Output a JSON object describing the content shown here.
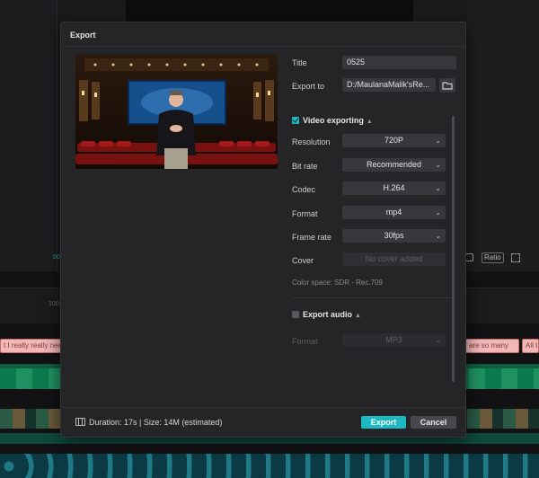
{
  "background": {
    "ratio_label": "Ratio",
    "time_left": "00",
    "ruler_mark": "100s",
    "captions": [
      "t I really really need",
      "are so many",
      "All t"
    ]
  },
  "dialog": {
    "title": "Export",
    "fields": {
      "title_label": "Title",
      "title_value": "0525",
      "export_to_label": "Export to",
      "export_to_value": "D:/MaulanaMalik'sRe..."
    },
    "video": {
      "heading": "Video exporting",
      "checked": true,
      "rows": [
        {
          "label": "Resolution",
          "value": "720P"
        },
        {
          "label": "Bit rate",
          "value": "Recommended"
        },
        {
          "label": "Codec",
          "value": "H.264"
        },
        {
          "label": "Format",
          "value": "mp4"
        },
        {
          "label": "Frame rate",
          "value": "30fps"
        }
      ],
      "cover_label": "Cover",
      "cover_value": "No cover added",
      "color_space": "Color space: SDR - Rec.709"
    },
    "audio": {
      "heading": "Export audio",
      "checked": false,
      "format_label": "Format",
      "format_value": "MP3"
    },
    "footer": {
      "info": "Duration: 17s | Size: 14M (estimated)",
      "export_label": "Export",
      "cancel_label": "Cancel"
    },
    "colors": {
      "accent": "#1cb9c2",
      "dialog_bg": "#252528",
      "field_bg": "#38383c"
    }
  }
}
